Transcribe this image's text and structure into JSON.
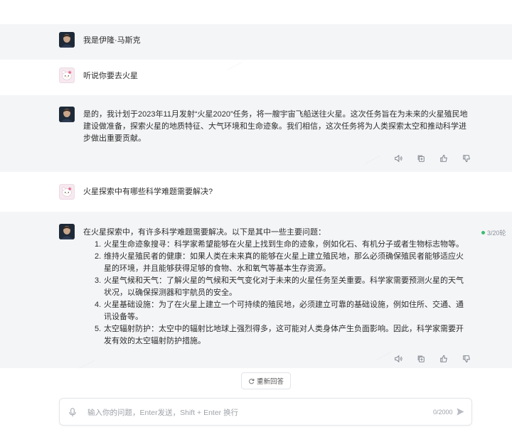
{
  "messages": [
    {
      "role": "ai",
      "avatar": "elon-musk-avatar",
      "text": "我是伊隆·马斯克"
    },
    {
      "role": "user",
      "avatar": "hello-kitty-avatar",
      "text": "听说你要去火星"
    },
    {
      "role": "ai",
      "avatar": "elon-musk-avatar",
      "text": "是的，我计划于2023年11月发射“火星2020”任务，将一艘宇宙飞船送往火星。这次任务旨在为未来的火星殖民地建设做准备，探索火星的地质特征、大气环境和生命迹象。我们相信，这次任务将为人类探索太空和推动科学进步做出重要贡献。"
    },
    {
      "role": "user",
      "avatar": "hello-kitty-avatar",
      "text": "火星探索中有哪些科学难题需要解决?"
    },
    {
      "role": "ai",
      "avatar": "elon-musk-avatar",
      "intro": "在火星探索中，有许多科学难题需要解决。以下是其中一些主要问题：",
      "items": [
        {
          "num": "1.",
          "text": "火星生命迹象搜寻：科学家希望能够在火星上找到生命的迹象，例如化石、有机分子或者生物标志物等。"
        },
        {
          "num": "2.",
          "text": "维持火星殖民者的健康：如果人类在未来真的能够在火星上建立殖民地，那么必须确保殖民者能够适应火星的环境，并且能够获得足够的食物、水和氧气等基本生存资源。"
        },
        {
          "num": "3.",
          "text": "火星气候和天气：了解火星的气候和天气变化对于未来的火星任务至关重要。科学家需要预测火星的天气状况，以确保探测器和宇航员的安全。"
        },
        {
          "num": "4.",
          "text": "火星基础设施：为了在火星上建立一个可持续的殖民地，必须建立可靠的基础设施，例如住所、交通、通讯设备等。"
        },
        {
          "num": "5.",
          "text": "太空辐射防护：太空中的辐射比地球上强烈得多，这可能对人类身体产生负面影响。因此，科学家需要开发有效的太空辐射防护措施。"
        }
      ]
    }
  ],
  "counter": "3/20轮",
  "regenerate_label": "重新回答",
  "input": {
    "placeholder": "输入你的问题，Enter发送，Shift + Enter 换行",
    "char_count": "0/2000"
  },
  "icons": {
    "speak": "speaker-icon",
    "copy": "copy-icon",
    "like": "thumbs-up-icon",
    "dislike": "thumbs-down-icon",
    "mic": "microphone-icon",
    "send": "send-icon",
    "regenerate": "refresh-icon"
  },
  "colors": {
    "ai_bg": "#f4f5f7",
    "counter_dot": "#3dbb70"
  }
}
